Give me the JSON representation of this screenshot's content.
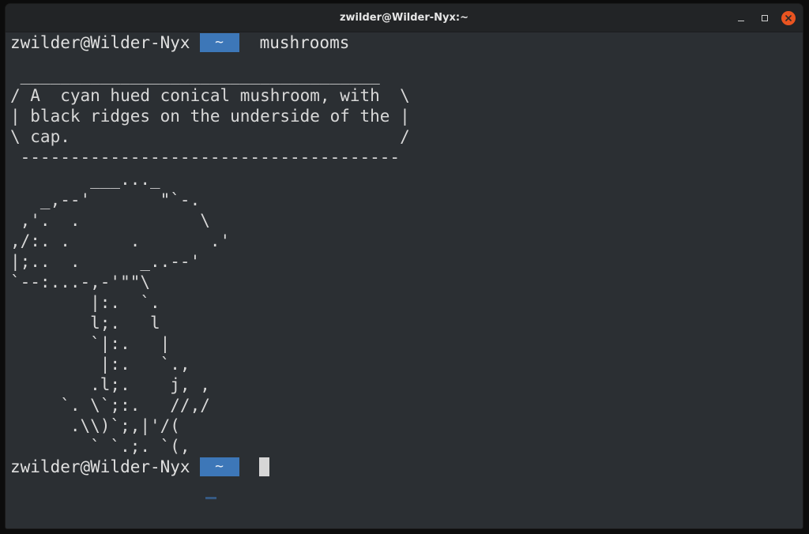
{
  "window": {
    "title": "zwilder@Wilder-Nyx:~",
    "accent_close": "#e95420"
  },
  "icons": {
    "minimize": "minimize-icon",
    "maximize": "maximize-icon",
    "close": "close-icon"
  },
  "prompt": {
    "user": "zwilder@Wilder-Nyx",
    "dir": "~",
    "command": "mushrooms",
    "dir_bg_color": "#3d77b8"
  },
  "output": {
    "bubble": [
      " ____________________________________",
      "/ A  cyan hued conical mushroom, with  \\",
      "| black ridges on the underside of the |",
      "\\ cap.                                 /",
      " --------------------------------------"
    ],
    "art": [
      "        ___..._",
      "   _,--'       \"`-.",
      " ,'.  .            \\",
      ",/:. .      .       .'",
      "|;..  .      _..--'",
      "`--:...-,-'\"\"\\",
      "        |:.  `.",
      "        l;.   l",
      "        `|:.   |",
      "         |:.   `.,",
      "        .l;.    j, ,",
      "     `. \\`;:.   //,/",
      "      .\\\\)`;,|'/(",
      "        ` `.;. `(,"
    ]
  },
  "prompt2": {
    "user": "zwilder@Wilder-Nyx",
    "dir": "~"
  }
}
